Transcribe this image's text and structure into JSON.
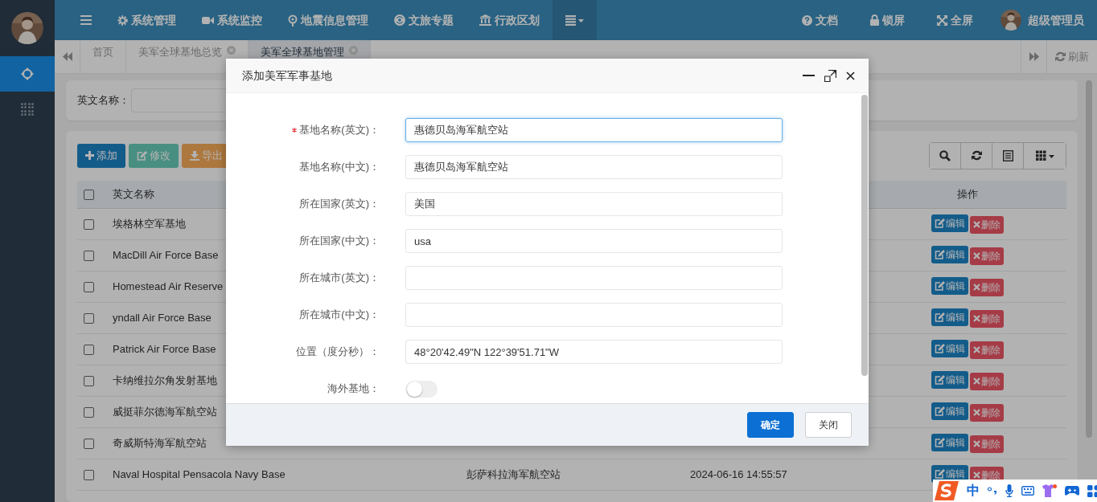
{
  "sidebar": {
    "items": [
      {
        "kind": "move",
        "selected": true
      },
      {
        "kind": "dots",
        "selected": false
      }
    ]
  },
  "topbar": {
    "menu": [
      {
        "kind": "hamburger",
        "selected": false
      },
      {
        "kind": "gear",
        "label": "系统管理",
        "selected": false
      },
      {
        "kind": "video",
        "label": "系统监控",
        "selected": false
      },
      {
        "kind": "pin",
        "label": "地震信息管理",
        "selected": false
      },
      {
        "kind": "ring",
        "label": "文旅专题",
        "selected": false
      },
      {
        "kind": "bank",
        "label": "行政区划",
        "selected": false
      },
      {
        "kind": "more",
        "selected": true
      }
    ],
    "right": [
      {
        "kind": "help",
        "label": "文档"
      },
      {
        "kind": "lock",
        "label": "锁屏"
      },
      {
        "kind": "fullscreen",
        "label": "全屏"
      }
    ],
    "user": {
      "name": "超级管理员"
    }
  },
  "tabs": [
    {
      "label": "首页",
      "closable": false,
      "selected": false
    },
    {
      "label": "美军全球基地总览",
      "closable": true,
      "selected": false
    },
    {
      "label": "美军全球基地管理",
      "closable": true,
      "selected": true
    }
  ],
  "tabs_refresh": {
    "label": "刷新"
  },
  "search": {
    "fields": [
      {
        "label": "英文名称："
      }
    ]
  },
  "toolbar": {
    "buttons": [
      {
        "kind": "add",
        "label": "添加",
        "disabled": false
      },
      {
        "kind": "edit",
        "label": "修改",
        "disabled": true
      },
      {
        "kind": "export",
        "label": "导出",
        "disabled": false
      }
    ],
    "tools": [
      {
        "kind": "search"
      },
      {
        "kind": "refresh"
      },
      {
        "kind": "list"
      },
      {
        "kind": "columns"
      }
    ]
  },
  "table": {
    "all_checked": false,
    "columns": [
      {
        "label": "英文名称"
      },
      {
        "label": "操作"
      }
    ],
    "rows": [
      {
        "checked": false,
        "name_en": "埃格林空军基地",
        "actions": [
          "编辑",
          "删除"
        ]
      },
      {
        "checked": false,
        "name_en": "MacDill Air Force Base",
        "actions": [
          "编辑",
          "删除"
        ]
      },
      {
        "checked": false,
        "name_en": "Homestead Air Reserve",
        "actions": [
          "编辑",
          "删除"
        ]
      },
      {
        "checked": false,
        "name_en": "yndall Air Force Base",
        "actions": [
          "编辑",
          "删除"
        ]
      },
      {
        "checked": false,
        "name_en": "Patrick Air Force Base",
        "actions": [
          "编辑",
          "删除"
        ]
      },
      {
        "checked": false,
        "name_en": "卡纳维拉尔角发射基地",
        "actions": [
          "编辑",
          "删除"
        ]
      },
      {
        "checked": false,
        "name_en": "威挺菲尔德海军航空站",
        "actions": [
          "编辑",
          "删除"
        ]
      },
      {
        "checked": false,
        "name_en": "奇威斯特海军航空站",
        "actions": [
          "编辑",
          "删除"
        ]
      },
      {
        "checked": false,
        "name_en": "Naval Hospital Pensacola Navy Base",
        "name_cn": "彭萨科拉海军航空站",
        "time": "2024-06-16 14:55:57",
        "actions": [
          "编辑",
          "删除"
        ]
      }
    ]
  },
  "modal": {
    "title": "添加美军军事基地",
    "fields": [
      {
        "kind": "text",
        "label": "基地名称(英文)：",
        "value": "惠德贝岛海军航空站",
        "required": true,
        "focused": true
      },
      {
        "kind": "text",
        "label": "基地名称(中文)：",
        "value": "惠德贝岛海军航空站",
        "required": false,
        "focused": false
      },
      {
        "kind": "text",
        "label": "所在国家(英文)：",
        "value": "美国",
        "required": false,
        "focused": false
      },
      {
        "kind": "text",
        "label": "所在国家(中文)：",
        "value": "usa",
        "required": false,
        "focused": false
      },
      {
        "kind": "text",
        "label": "所在城市(英文)：",
        "required": false,
        "focused": false
      },
      {
        "kind": "text",
        "label": "所在城市(中文)：",
        "required": false,
        "focused": false
      },
      {
        "kind": "text",
        "label": "位置（度分秒）：",
        "value": "48°20'42.49\"N 122°39'51.71\"W",
        "required": false,
        "focused": false
      },
      {
        "kind": "switch",
        "label": "海外基地：",
        "on": false,
        "required": false
      }
    ],
    "buttons": [
      {
        "kind": "primary",
        "label": "确定"
      },
      {
        "kind": "default",
        "label": "关闭"
      }
    ]
  },
  "ime": {
    "mode": "中"
  }
}
